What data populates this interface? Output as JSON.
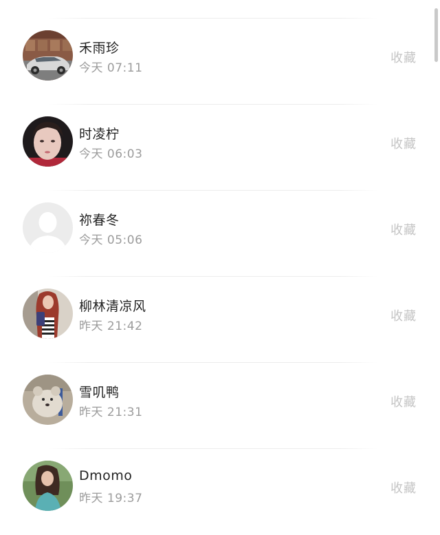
{
  "contacts": [
    {
      "name": "禾雨珍",
      "time": "今天 07:11",
      "action": "收藏",
      "avatar_icon": "car-photo-icon"
    },
    {
      "name": "时凌柠",
      "time": "今天 06:03",
      "action": "收藏",
      "avatar_icon": "portrait-photo-icon"
    },
    {
      "name": "祢春冬",
      "time": "今天 05:06",
      "action": "收藏",
      "avatar_icon": "default-user-icon"
    },
    {
      "name": "柳林清凉风",
      "time": "昨天 21:42",
      "action": "收藏",
      "avatar_icon": "portrait-photo-icon"
    },
    {
      "name": "雪叽鸭",
      "time": "昨天 21:31",
      "action": "收藏",
      "avatar_icon": "animal-photo-icon"
    },
    {
      "name": "Dmomo",
      "time": "昨天 19:37",
      "action": "收藏",
      "avatar_icon": "portrait-photo-icon"
    }
  ],
  "colors": {
    "name_text": "#222222",
    "time_text": "#9b9b9b",
    "action_text": "#c4c4c4"
  }
}
